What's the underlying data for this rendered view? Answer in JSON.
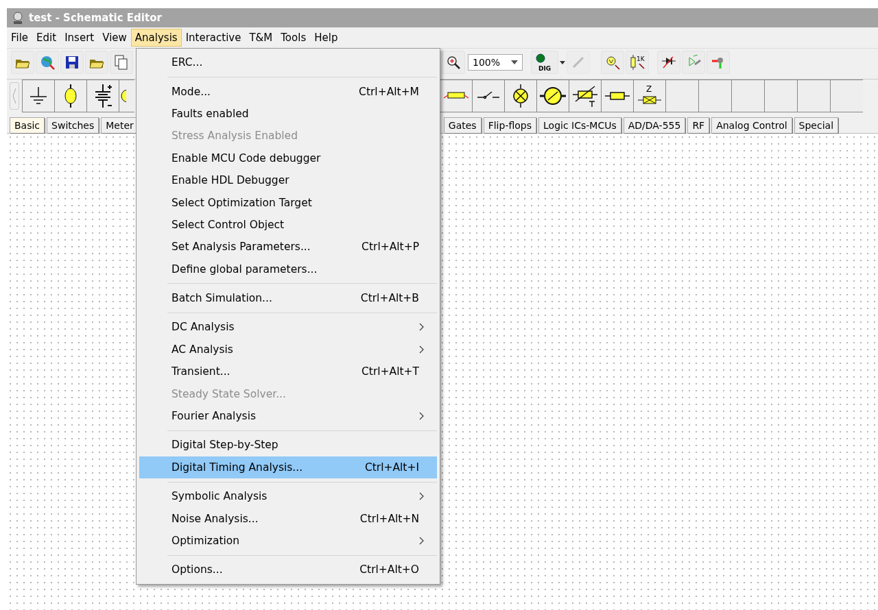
{
  "window": {
    "title": "test - Schematic Editor"
  },
  "menubar": [
    {
      "label": "File",
      "selected": false
    },
    {
      "label": "Edit",
      "selected": false
    },
    {
      "label": "Insert",
      "selected": false
    },
    {
      "label": "View",
      "selected": false
    },
    {
      "label": "Analysis",
      "selected": true
    },
    {
      "label": "Interactive",
      "selected": false
    },
    {
      "label": "T&M",
      "selected": false
    },
    {
      "label": "Tools",
      "selected": false
    },
    {
      "label": "Help",
      "selected": false
    }
  ],
  "toolbar": {
    "zoom": "100%",
    "dig_label": "DIG",
    "probe_label": "1K"
  },
  "components": {
    "impedance_label": "Z"
  },
  "tabs_left": [
    {
      "label": "Basic",
      "selected": true
    },
    {
      "label": "Switches",
      "selected": false
    },
    {
      "label": "Meter",
      "selected": false
    }
  ],
  "tabs_right": [
    {
      "label": "Gates",
      "selected": false
    },
    {
      "label": "Flip-flops",
      "selected": false
    },
    {
      "label": "Logic ICs-MCUs",
      "selected": false
    },
    {
      "label": "AD/DA-555",
      "selected": false
    },
    {
      "label": "RF",
      "selected": false
    },
    {
      "label": "Analog Control",
      "selected": false
    },
    {
      "label": "Special",
      "selected": false
    }
  ],
  "menu": [
    {
      "kind": "item",
      "label": "ERC...",
      "disabled": false,
      "selected": false,
      "submenu": false
    },
    {
      "kind": "separator"
    },
    {
      "kind": "item",
      "label": "Mode...",
      "shortcut": "Ctrl+Alt+M",
      "disabled": false,
      "selected": false,
      "submenu": false
    },
    {
      "kind": "item",
      "label": "Faults enabled",
      "disabled": false,
      "selected": false,
      "submenu": false
    },
    {
      "kind": "item",
      "label": "Stress Analysis Enabled",
      "disabled": true,
      "selected": false,
      "submenu": false
    },
    {
      "kind": "item",
      "label": "Enable MCU Code debugger",
      "disabled": false,
      "selected": false,
      "submenu": false
    },
    {
      "kind": "item",
      "label": "Enable HDL Debugger",
      "disabled": false,
      "selected": false,
      "submenu": false
    },
    {
      "kind": "item",
      "label": "Select Optimization Target",
      "disabled": false,
      "selected": false,
      "submenu": false
    },
    {
      "kind": "item",
      "label": "Select Control Object",
      "disabled": false,
      "selected": false,
      "submenu": false
    },
    {
      "kind": "item",
      "label": "Set Analysis Parameters...",
      "shortcut": "Ctrl+Alt+P",
      "disabled": false,
      "selected": false,
      "submenu": false
    },
    {
      "kind": "item",
      "label": "Define global parameters...",
      "disabled": false,
      "selected": false,
      "submenu": false
    },
    {
      "kind": "separator"
    },
    {
      "kind": "item",
      "label": "Batch Simulation...",
      "shortcut": "Ctrl+Alt+B",
      "disabled": false,
      "selected": false,
      "submenu": false
    },
    {
      "kind": "separator"
    },
    {
      "kind": "item",
      "label": "DC Analysis",
      "disabled": false,
      "selected": false,
      "submenu": true
    },
    {
      "kind": "item",
      "label": "AC Analysis",
      "disabled": false,
      "selected": false,
      "submenu": true
    },
    {
      "kind": "item",
      "label": "Transient...",
      "shortcut": "Ctrl+Alt+T",
      "disabled": false,
      "selected": false,
      "submenu": false
    },
    {
      "kind": "item",
      "label": "Steady State Solver...",
      "disabled": true,
      "selected": false,
      "submenu": false
    },
    {
      "kind": "item",
      "label": "Fourier Analysis",
      "disabled": false,
      "selected": false,
      "submenu": true
    },
    {
      "kind": "separator"
    },
    {
      "kind": "item",
      "label": "Digital Step-by-Step",
      "disabled": false,
      "selected": false,
      "submenu": false
    },
    {
      "kind": "item",
      "label": "Digital Timing Analysis...",
      "shortcut": "Ctrl+Alt+I",
      "disabled": false,
      "selected": true,
      "submenu": false
    },
    {
      "kind": "separator"
    },
    {
      "kind": "item",
      "label": "Symbolic Analysis",
      "disabled": false,
      "selected": false,
      "submenu": true
    },
    {
      "kind": "item",
      "label": "Noise Analysis...",
      "shortcut": "Ctrl+Alt+N",
      "disabled": false,
      "selected": false,
      "submenu": false
    },
    {
      "kind": "item",
      "label": "Optimization",
      "disabled": false,
      "selected": false,
      "submenu": true
    },
    {
      "kind": "separator"
    },
    {
      "kind": "item",
      "label": "Options...",
      "shortcut": "Ctrl+Alt+O",
      "disabled": false,
      "selected": false,
      "submenu": false
    }
  ]
}
